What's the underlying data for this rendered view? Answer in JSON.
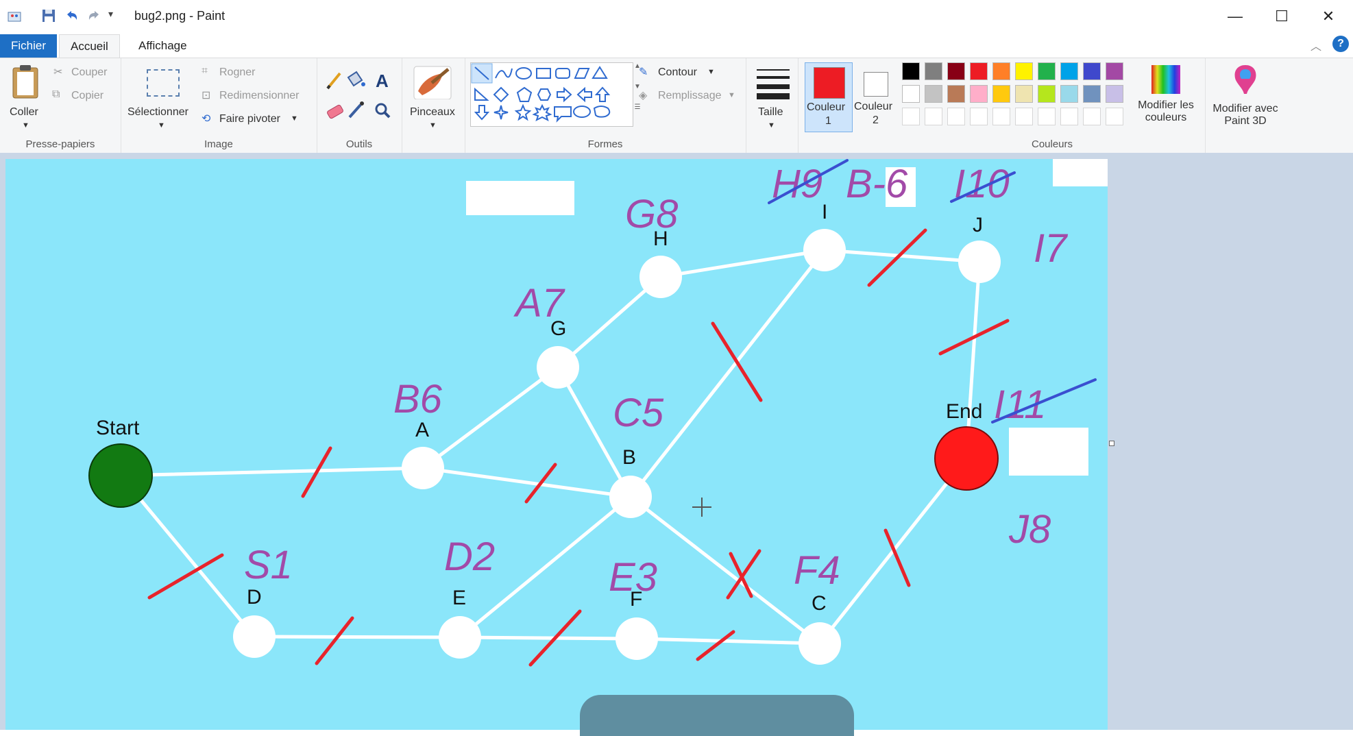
{
  "window": {
    "title": "bug2.png - Paint",
    "controls": {
      "minimize": "—",
      "maximize": "☐",
      "close": "✕"
    }
  },
  "tabs": [
    "Fichier",
    "Accueil",
    "Affichage"
  ],
  "ribbon": {
    "clipboard": {
      "paste": "Coller",
      "cut": "Couper",
      "copy": "Copier",
      "group": "Presse-papiers"
    },
    "image": {
      "select": "Sélectionner",
      "crop": "Rogner",
      "resize": "Redimensionner",
      "rotate": "Faire pivoter",
      "group": "Image"
    },
    "tools": {
      "group": "Outils"
    },
    "brushes": {
      "label": "Pinceaux"
    },
    "shapes": {
      "outline": "Contour",
      "fill": "Remplissage",
      "group": "Formes"
    },
    "size": {
      "label": "Taille"
    },
    "color1": {
      "label1": "Couleur",
      "label2": "1",
      "value": "#ed1c24"
    },
    "color2": {
      "label1": "Couleur",
      "label2": "2",
      "value": "#ffffff"
    },
    "colors_group": "Couleurs",
    "palette_row1": [
      "#000000",
      "#7f7f7f",
      "#880015",
      "#ed1c24",
      "#ff7f27",
      "#fff200",
      "#22b14c",
      "#00a2e8",
      "#3f48cc",
      "#a349a4"
    ],
    "palette_row2": [
      "#ffffff",
      "#c3c3c3",
      "#b97a57",
      "#ffaec9",
      "#ffc90e",
      "#efe4b0",
      "#b5e61d",
      "#99d9ea",
      "#7092be",
      "#c8bfe7"
    ],
    "edit_colors": {
      "line1": "Modifier les",
      "line2": "couleurs"
    },
    "paint3d": {
      "line1": "Modifier avec",
      "line2": "Paint 3D"
    }
  },
  "graph": {
    "node_labels": {
      "start": "Start",
      "end": "End",
      "a": "A",
      "b": "B",
      "c": "C",
      "d": "D",
      "e": "E",
      "f": "F",
      "g": "G",
      "h": "H",
      "i": "I",
      "j": "J"
    },
    "annotations": {
      "s1": "S1",
      "d2": "D2",
      "e3": "E3",
      "f4": "F4",
      "c5": "C5",
      "b6": "B6",
      "a7": "A7",
      "g8": "G8",
      "b6_top": "B-6",
      "j8": "J8",
      "i7": "I7",
      "h9": "H9",
      "i10": "I10",
      "i11": "I11"
    },
    "colors": {
      "canvas": "#8be6fa",
      "edge": "#ffffff",
      "strike": "#e8232b",
      "ink": "#a24aa8",
      "blue_strike": "#3a4fd0",
      "start": "#127a12",
      "end": "#ff1a1a"
    }
  }
}
